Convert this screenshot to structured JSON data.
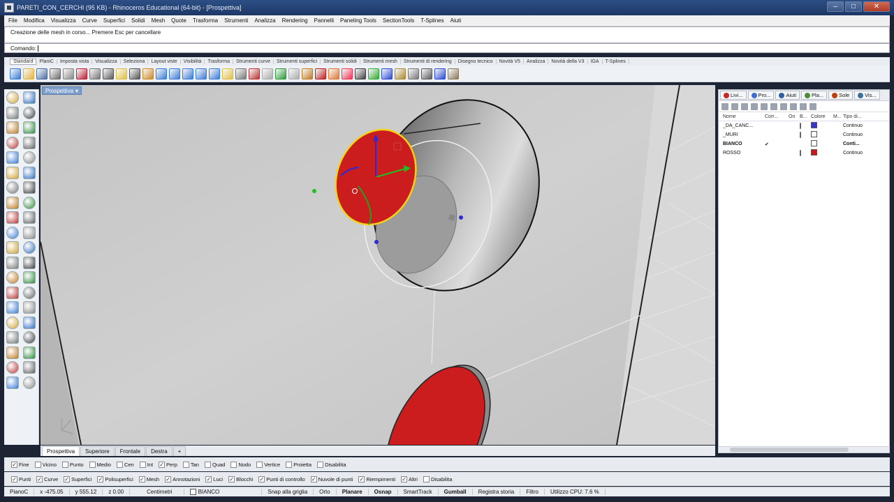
{
  "window": {
    "title": "PARETI_CON_CERCHI (95 KB) - Rhinoceros Educational (64-bit) - [Prospettiva]"
  },
  "menu": [
    "File",
    "Modifica",
    "Visualizza",
    "Curve",
    "Superfici",
    "Solidi",
    "Mesh",
    "Quote",
    "Trasforma",
    "Strumenti",
    "Analizza",
    "Rendering",
    "Pannelli",
    "Paneling Tools",
    "SectionTools",
    "T-Splines",
    "Aiuti"
  ],
  "command": {
    "history": "Creazione delle mesh in corso... Premere Esc per cancellare",
    "prompt_label": "Comando:"
  },
  "toolbar_tabs": [
    "Standard",
    "PlaniC",
    "Imposta vista",
    "Visualizza",
    "Seleziona",
    "Layout viste",
    "Visibilità",
    "Trasforma",
    "Strumenti curve",
    "Strumenti superfici",
    "Strumenti solidi",
    "Strumenti mesh",
    "Strumenti di rendering",
    "Disegno tecnico",
    "Novità V5",
    "Analizza",
    "Novità della V3",
    "IGA",
    "T-Splines"
  ],
  "toolbar_active_tab": "Standard",
  "viewport": {
    "label": "Prospettiva",
    "tabs": [
      "Prospettiva",
      "Superiore",
      "Frontale",
      "Destra"
    ],
    "add_tab_icon": "+"
  },
  "panel": {
    "tabs": [
      {
        "label": "Livi...",
        "color": "#c62828"
      },
      {
        "label": "Pro...",
        "color": "#3b6fd1"
      },
      {
        "label": "Aiuti",
        "color": "#2b5fa6"
      },
      {
        "label": "Pla...",
        "color": "#4b8a3a"
      },
      {
        "label": "Sole",
        "color": "#c04010"
      },
      {
        "label": "Vis...",
        "color": "#3a6fa0"
      }
    ],
    "columns": [
      "Nome",
      "Corr...",
      "On",
      "B...",
      "Colore",
      "M...",
      "Tipo di..."
    ],
    "layers": [
      {
        "name": "_DA_CANC...",
        "current": "",
        "color": "#3a36c8",
        "linetype": "Continuo",
        "bold": false,
        "bulb": true
      },
      {
        "name": "_MURI",
        "current": "",
        "color": "#ffffff",
        "linetype": "Continuo",
        "bold": false,
        "bulb": true
      },
      {
        "name": "BIANCO",
        "current": "✔",
        "color": "#ffffff",
        "linetype": "Conti...",
        "bold": true,
        "bulb": false
      },
      {
        "name": "ROSSO",
        "current": "",
        "color": "#c41d1d",
        "linetype": "Continuo",
        "bold": false,
        "bulb": true
      }
    ]
  },
  "osnap_row1": [
    {
      "label": "Fine",
      "checked": true
    },
    {
      "label": "Vicino",
      "checked": false
    },
    {
      "label": "Punto",
      "checked": false
    },
    {
      "label": "Medio",
      "checked": false
    },
    {
      "label": "Cen",
      "checked": false
    },
    {
      "label": "Int",
      "checked": false
    },
    {
      "label": "Perp",
      "checked": true
    },
    {
      "label": "Tan",
      "checked": false
    },
    {
      "label": "Quad",
      "checked": false
    },
    {
      "label": "Nodo",
      "checked": false
    },
    {
      "label": "Vertice",
      "checked": false
    },
    {
      "label": "Proietta",
      "checked": false
    },
    {
      "label": "Disabilita",
      "checked": false
    }
  ],
  "osnap_row2": [
    {
      "label": "Punti",
      "checked": true
    },
    {
      "label": "Curve",
      "checked": true
    },
    {
      "label": "Superfici",
      "checked": true
    },
    {
      "label": "Polisuperfici",
      "checked": true
    },
    {
      "label": "Mesh",
      "checked": true
    },
    {
      "label": "Annotazioni",
      "checked": true
    },
    {
      "label": "Luci",
      "checked": true
    },
    {
      "label": "Blocchi",
      "checked": true
    },
    {
      "label": "Punti di controllo",
      "checked": true
    },
    {
      "label": "Nuvole di punti",
      "checked": true
    },
    {
      "label": "Riempimenti",
      "checked": true
    },
    {
      "label": "Altri",
      "checked": true
    },
    {
      "label": "Disabilita",
      "checked": false
    }
  ],
  "status": {
    "cplane": "PianoC",
    "x": "x -475.05",
    "y": "y 555.12",
    "z": "z 0.00",
    "units": "Centimetri",
    "layer": "BIANCO",
    "items": [
      "Snap alla griglia",
      "Orto",
      "Planare",
      "Osnap",
      "SmartTrack",
      "Gumball",
      "Registra storia",
      "Filtro"
    ],
    "bold_items": [
      "Planare",
      "Osnap",
      "Gumball"
    ],
    "cpu": "Utilizzo CPU: 7.6 %"
  }
}
